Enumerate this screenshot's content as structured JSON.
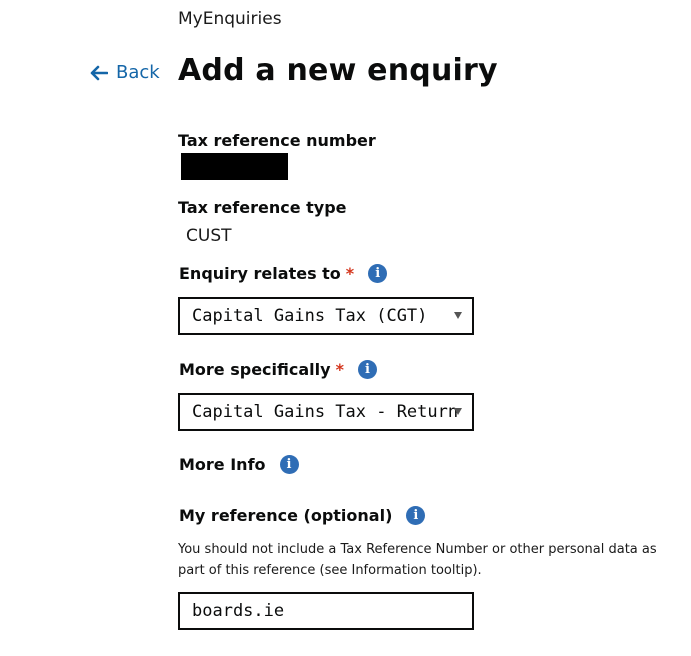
{
  "app": {
    "name": "MyEnquiries"
  },
  "nav": {
    "back_label": "Back"
  },
  "page": {
    "title": "Add a new enquiry"
  },
  "fields": {
    "tax_reference_number": {
      "label": "Tax reference number"
    },
    "tax_reference_type": {
      "label": "Tax reference type",
      "value": "CUST"
    },
    "enquiry_relates_to": {
      "label": "Enquiry relates to",
      "required_marker": "*",
      "value": "Capital Gains Tax (CGT)"
    },
    "more_specifically": {
      "label": "More specifically",
      "required_marker": "*",
      "value": "Capital Gains Tax - Return"
    },
    "more_info": {
      "label": "More Info"
    },
    "my_reference": {
      "label": "My reference (optional)",
      "hint": "You should not include a Tax Reference Number or other personal data as part of this reference (see Information tooltip).",
      "value": "boards.ie"
    }
  },
  "icons": {
    "info_glyph": "i",
    "back_arrow": "arrow-left-icon"
  },
  "colors": {
    "link": "#1466a8",
    "info_icon": "#2f6db5",
    "required": "#d4351c"
  }
}
